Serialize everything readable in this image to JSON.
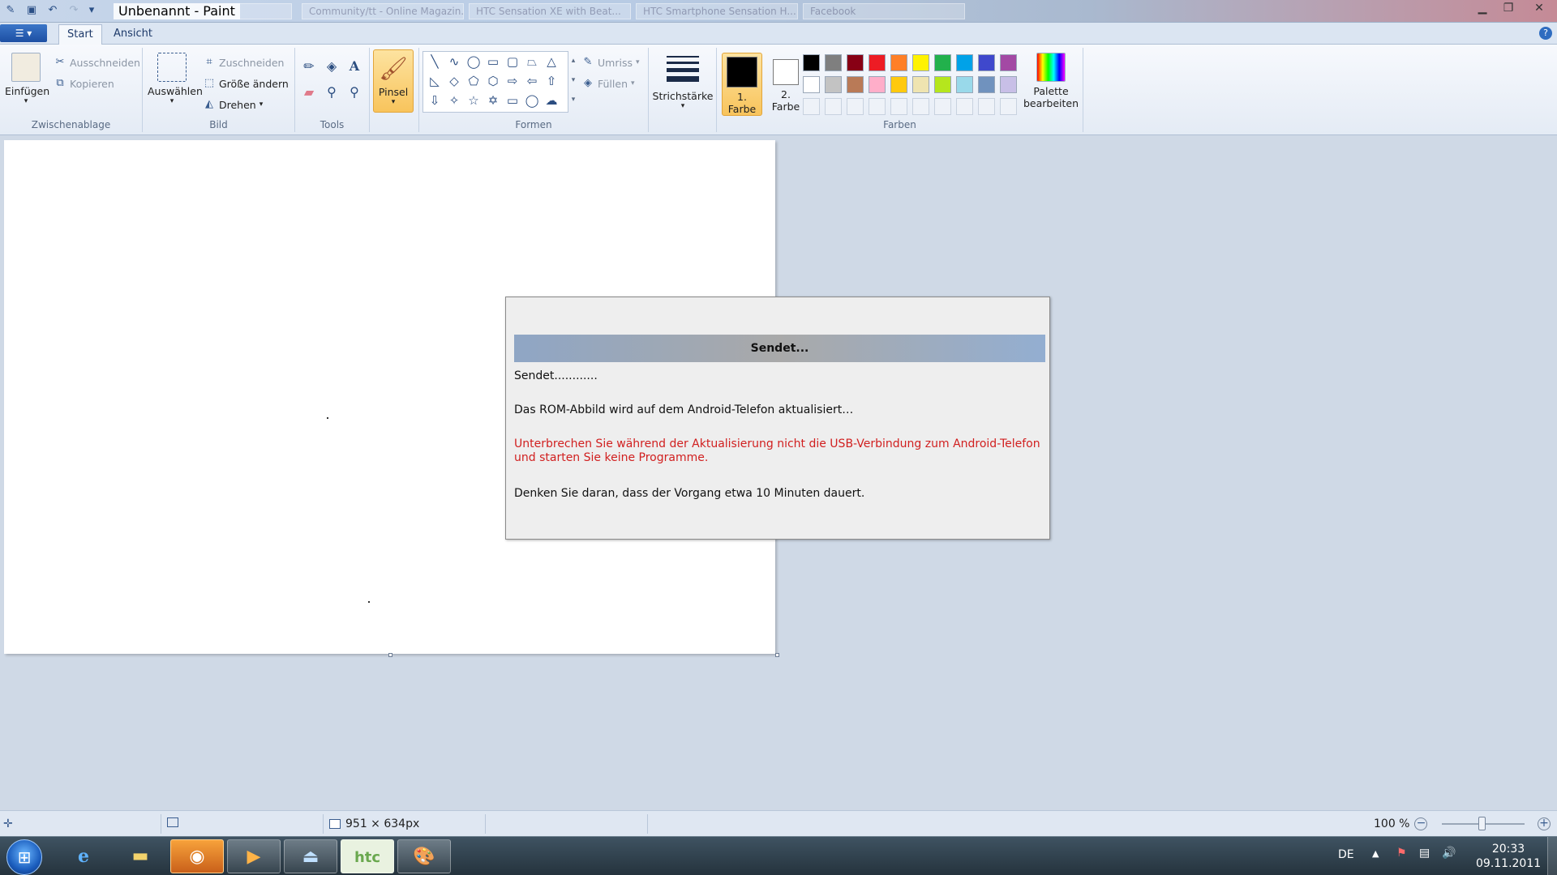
{
  "window": {
    "title": "Unbenannt - Paint",
    "background_tabs": [
      "",
      "Community/tt - Online Magazin...",
      "HTC Sensation XE with Beat...",
      "HTC Smartphone Sensation H...",
      "Facebook"
    ]
  },
  "ribbon_tabs": [
    {
      "label": "Start",
      "active": true
    },
    {
      "label": "Ansicht",
      "active": false
    }
  ],
  "groups": {
    "clipboard": {
      "title": "Zwischenablage",
      "paste": "Einfügen",
      "cut": "Ausschneiden",
      "copy": "Kopieren"
    },
    "image": {
      "title": "Bild",
      "select": "Auswählen",
      "crop": "Zuschneiden",
      "resize": "Größe ändern",
      "rotate": "Drehen"
    },
    "tools": {
      "title": "Tools"
    },
    "brush": {
      "label": "Pinsel"
    },
    "shapes": {
      "title": "Formen",
      "outline": "Umriss",
      "fill": "Füllen"
    },
    "stroke": {
      "label": "Strichstärke"
    },
    "colors": {
      "title": "Farben",
      "color1_line1": "1.",
      "color1_line2": "Farbe",
      "color2_line1": "2.",
      "color2_line2": "Farbe",
      "edit_line1": "Palette",
      "edit_line2": "bearbeiten",
      "color1": "#000000",
      "color2": "#ffffff",
      "palette": [
        "#000000",
        "#7f7f7f",
        "#880015",
        "#ed1c24",
        "#ff7f27",
        "#fff200",
        "#22b14c",
        "#00a2e8",
        "#3f48cc",
        "#a349a4",
        "#ffffff",
        "#c3c3c3",
        "#b97a57",
        "#ffaec9",
        "#ffc90e",
        "#efe4b0",
        "#b5e61d",
        "#99d9ea",
        "#7092be",
        "#c8bfe7"
      ]
    }
  },
  "dialog": {
    "header": "Sendet...",
    "line1": "Sendet............",
    "line2": "Das ROM-Abbild wird auf dem Android-Telefon aktualisiert…",
    "warning": "Unterbrechen Sie während der Aktualisierung nicht die USB-Verbindung zum Android-Telefon und starten Sie keine Programme.",
    "line4": "Denken Sie daran, dass der Vorgang etwa 10 Minuten dauert."
  },
  "statusbar": {
    "image_size": "951 × 634px",
    "zoom": "100 %"
  },
  "taskbar": {
    "htc_label": "htc",
    "language": "DE",
    "time": "20:33",
    "date": "09.11.2011"
  }
}
